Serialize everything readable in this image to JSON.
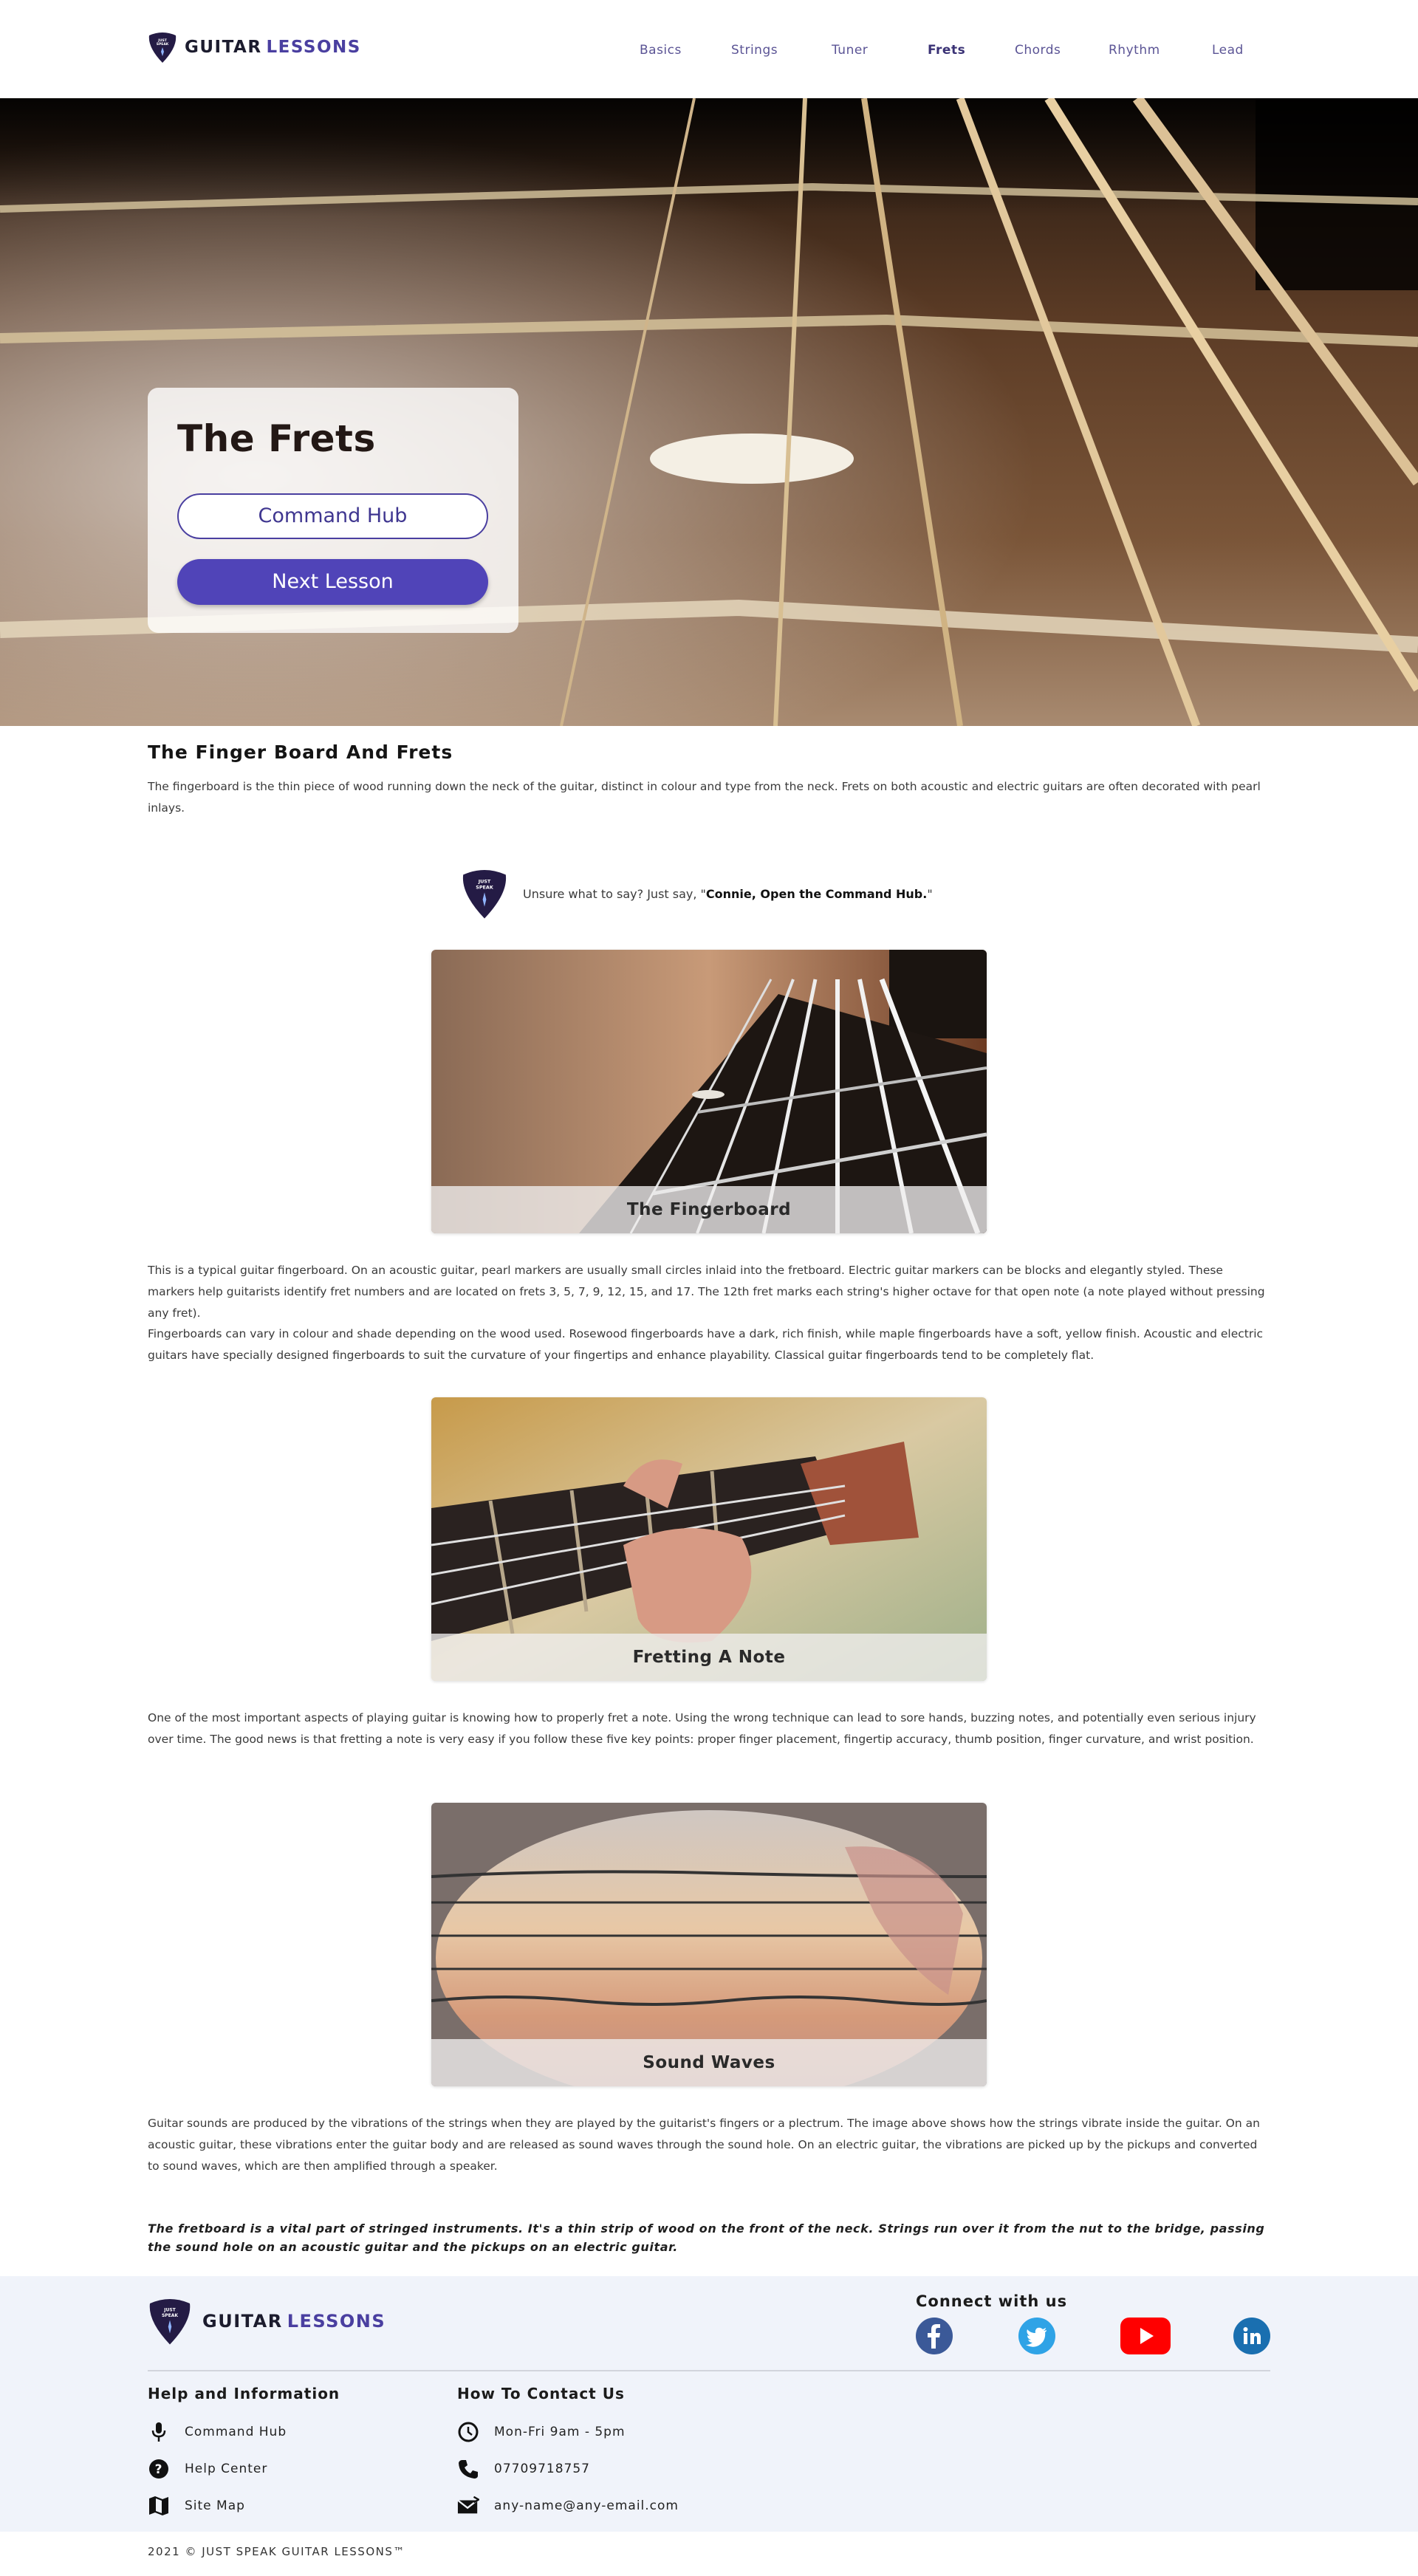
{
  "brand": {
    "name": "GUITAR",
    "accent": "LESSONS",
    "pick_text_top": "JUST",
    "pick_text_bottom": "SPEAK"
  },
  "nav": [
    "Basics",
    "Strings",
    "Tuner",
    "Frets",
    "Chords",
    "Rhythm",
    "Lead"
  ],
  "nav_active": "Frets",
  "hero": {
    "title": "The Frets",
    "command_hub_label": "Command Hub",
    "next_lesson_label": "Next Lesson"
  },
  "intro": {
    "heading": "The Finger Board And Frets",
    "text": "The fingerboard is the thin piece of wood running down the neck of the guitar, distinct in colour and type from the neck. Frets on both acoustic and electric guitars are often decorated with pearl inlays."
  },
  "tip": {
    "prefix": "Unsure what to say? Just say, \"",
    "command": "Connie, Open the Command Hub.",
    "suffix": "\""
  },
  "figures": [
    {
      "caption": "The Fingerboard"
    },
    {
      "caption": "Fretting A Note"
    },
    {
      "caption": "Sound Waves"
    }
  ],
  "paragraphs": {
    "fingerboard_1": "This is a typical guitar fingerboard. On an acoustic guitar, pearl markers are usually small circles inlaid into the fretboard. Electric guitar markers can be blocks and elegantly styled. These markers help guitarists identify fret numbers and are located on frets 3, 5, 7, 9, 12, 15, and 17. The 12th fret marks each string's higher octave for that open note (a note played without pressing any fret).",
    "fingerboard_2": "Fingerboards can vary in colour and shade depending on the wood used. Rosewood fingerboards have a dark, rich finish, while maple fingerboards have a soft, yellow finish. Acoustic and electric guitars have specially designed fingerboards to suit the curvature of your fingertips and enhance playability. Classical guitar fingerboards tend to be completely flat.",
    "fretting": "One of the most important aspects of playing guitar is knowing how to properly fret a note. Using the wrong technique can lead to sore hands, buzzing notes, and potentially even serious injury over time. The good news is that fretting a note is very easy if you follow these five key points: proper finger placement, fingertip accuracy, thumb position, finger curvature, and wrist position.",
    "sound": "Guitar sounds are produced by the vibrations of the strings when they are played by the guitarist's fingers or a plectrum. The image above shows how the strings vibrate inside the guitar. On an acoustic guitar, these vibrations enter the guitar body and are released as sound waves through the sound hole. On an electric guitar, the vibrations are picked up by the pickups and converted to sound waves, which are then amplified through a speaker.",
    "quote": "The fretboard is a vital part of stringed instruments. It's a thin strip of wood on the front of the neck. Strings run over it from the nut to the bridge, passing the sound hole on an acoustic guitar and the pickups on an electric guitar."
  },
  "footer": {
    "connect_title": "Connect with us",
    "social": [
      "facebook-icon",
      "twitter-icon",
      "youtube-icon",
      "linkedin-icon"
    ],
    "help_title": "Help and Information",
    "help_items": [
      "Command Hub",
      "Help Center",
      "Site Map"
    ],
    "contact_title": "How To Contact Us",
    "contact_items": [
      "Mon-Fri 9am - 5pm",
      "07709718757",
      "any-name@any-email.com"
    ],
    "copyright": "2021 © JUST SPEAK GUITAR LESSONS™"
  },
  "colors": {
    "accent": "#4a3fa0",
    "button": "#5044b8",
    "footer_bg": "#f0f3fa",
    "pick": "#241b45"
  }
}
